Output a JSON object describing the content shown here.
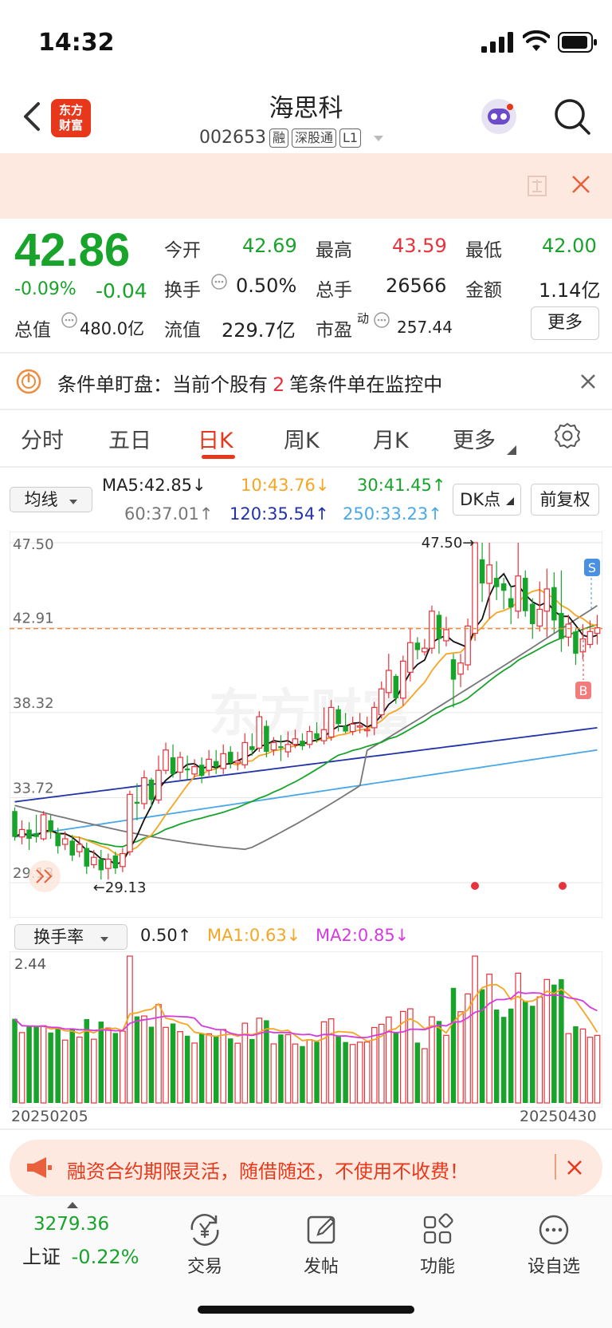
{
  "status": {
    "time": "14:32"
  },
  "header": {
    "logo_line1": "东方",
    "logo_line2": "财富",
    "stock_name": "海思科",
    "stock_code": "002653",
    "tags": [
      "融",
      "深股通",
      "L1"
    ]
  },
  "banner_top": {
    "close": "✕"
  },
  "quote": {
    "price": "42.86",
    "change_pct": "-0.09%",
    "change": "-0.04",
    "open_label": "今开",
    "open": "42.69",
    "high_label": "最高",
    "high": "43.59",
    "low_label": "最低",
    "low": "42.00",
    "turnover_label": "换手",
    "turnover": "0.50%",
    "volume_label": "总手",
    "volume": "26566",
    "amount_label": "金额",
    "amount": "1.14亿",
    "mktcap_label": "总值",
    "mktcap": "480.0亿",
    "float_label": "流值",
    "float": "229.7亿",
    "pe_label": "市盈",
    "pe_sup": "动",
    "pe": "257.44",
    "more": "更多"
  },
  "condition": {
    "prefix": "条件单盯盘：当前个股有",
    "count": "2",
    "suffix": "笔条件单在监控中",
    "close": "✕"
  },
  "tabs": [
    "分时",
    "五日",
    "日K",
    "周K",
    "月K",
    "更多"
  ],
  "ma_row": {
    "selector": "均线",
    "ma5": "MA5:42.85↓",
    "ma10": "10:43.76↓",
    "ma30": "30:41.45↑",
    "ma60": "60:37.01↑",
    "ma120": "120:35.54↑",
    "ma250": "250:33.23↑",
    "dk": "DK点",
    "fq": "前复权"
  },
  "colors": {
    "up": "#e8333c",
    "down": "#18a32a",
    "accent": "#e8381c"
  },
  "chart_data": {
    "type": "candlestick",
    "y_ticks": [
      "47.50",
      "42.91",
      "38.32",
      "33.72",
      "29.13"
    ],
    "ylim": [
      29.13,
      47.5
    ],
    "current_price_line": 42.86,
    "max_label": "47.50→",
    "min_label": "←29.13",
    "start_date": "20250205",
    "end_date": "20250430",
    "candles": [
      [
        33.0,
        31.6,
        33.2,
        31.4
      ],
      [
        31.6,
        32.0,
        32.5,
        31.2
      ],
      [
        32.0,
        31.5,
        32.4,
        30.9
      ],
      [
        31.8,
        31.6,
        32.8,
        31.3
      ],
      [
        31.5,
        32.8,
        33.0,
        31.4
      ],
      [
        32.5,
        31.9,
        32.8,
        31.5
      ],
      [
        31.8,
        31.1,
        32.1,
        30.7
      ],
      [
        31.2,
        31.5,
        31.9,
        30.9
      ],
      [
        31.4,
        30.6,
        31.7,
        30.3
      ],
      [
        30.8,
        31.2,
        31.6,
        30.5
      ],
      [
        31.0,
        30.0,
        31.3,
        29.6
      ],
      [
        30.1,
        30.5,
        30.9,
        29.9
      ],
      [
        30.4,
        29.8,
        30.9,
        29.3
      ],
      [
        29.9,
        30.4,
        30.7,
        29.3
      ],
      [
        30.6,
        29.9,
        30.8,
        29.6
      ],
      [
        30.0,
        30.7,
        31.0,
        29.7
      ],
      [
        30.8,
        33.9,
        34.1,
        30.6
      ],
      [
        33.5,
        33.4,
        34.5,
        32.5
      ],
      [
        33.4,
        34.8,
        35.2,
        33.1
      ],
      [
        34.7,
        33.6,
        34.8,
        33.2
      ],
      [
        33.6,
        35.2,
        36.0,
        33.4
      ],
      [
        35.2,
        36.3,
        36.7,
        35.0
      ],
      [
        35.9,
        35.0,
        36.6,
        34.8
      ],
      [
        35.1,
        35.9,
        36.2,
        34.7
      ],
      [
        35.3,
        35.2,
        36.0,
        34.7
      ],
      [
        35.0,
        35.4,
        35.8,
        34.8
      ],
      [
        35.5,
        34.9,
        35.9,
        34.5
      ],
      [
        35.2,
        35.8,
        36.3,
        34.9
      ],
      [
        35.7,
        35.4,
        36.3,
        35.0
      ],
      [
        35.3,
        36.1,
        36.6,
        35.0
      ],
      [
        36.2,
        35.6,
        36.5,
        35.3
      ],
      [
        35.6,
        35.7,
        36.2,
        35.2
      ],
      [
        35.5,
        36.7,
        37.2,
        35.3
      ],
      [
        36.5,
        36.3,
        37.2,
        36.0
      ],
      [
        36.4,
        38.1,
        38.4,
        36.2
      ],
      [
        37.6,
        36.2,
        37.9,
        35.9
      ],
      [
        36.3,
        36.7,
        37.0,
        36.0
      ],
      [
        36.5,
        36.4,
        37.1,
        35.7
      ],
      [
        36.2,
        36.6,
        37.3,
        35.9
      ],
      [
        36.6,
        36.9,
        37.4,
        36.4
      ],
      [
        36.8,
        36.5,
        37.2,
        36.3
      ],
      [
        36.6,
        37.3,
        37.6,
        36.4
      ],
      [
        37.2,
        36.9,
        37.8,
        36.7
      ],
      [
        36.8,
        37.4,
        38.6,
        36.6
      ],
      [
        37.0,
        38.6,
        39.0,
        36.8
      ],
      [
        38.5,
        37.7,
        38.7,
        37.3
      ],
      [
        37.6,
        37.3,
        38.3,
        37.2
      ],
      [
        37.3,
        37.7,
        38.1,
        37.1
      ],
      [
        37.6,
        37.6,
        38.3,
        37.2
      ],
      [
        37.4,
        37.4,
        38.1,
        37.0
      ],
      [
        37.5,
        38.6,
        38.9,
        37.1
      ],
      [
        38.2,
        39.6,
        40.0,
        38.0
      ],
      [
        39.4,
        40.6,
        41.5,
        39.1
      ],
      [
        40.3,
        39.1,
        40.4,
        38.8
      ],
      [
        39.1,
        41.1,
        41.4,
        38.7
      ],
      [
        40.5,
        42.1,
        42.9,
        40.0
      ],
      [
        42.1,
        41.7,
        42.4,
        41.2
      ],
      [
        41.6,
        41.8,
        42.3,
        41.4
      ],
      [
        41.8,
        43.8,
        44.1,
        41.5
      ],
      [
        43.6,
        42.3,
        43.8,
        41.5
      ],
      [
        42.2,
        42.8,
        43.5,
        41.9
      ],
      [
        41.2,
        40.1,
        41.5,
        38.6
      ],
      [
        40.4,
        41.0,
        41.5,
        39.7
      ],
      [
        40.9,
        43.0,
        43.4,
        40.6
      ],
      [
        42.6,
        47.5,
        47.5,
        42.2
      ],
      [
        46.6,
        45.3,
        47.5,
        44.3
      ],
      [
        45.3,
        46.3,
        47.5,
        43.4
      ],
      [
        45.6,
        45.1,
        46.5,
        44.4
      ],
      [
        45.3,
        44.9,
        45.6,
        43.9
      ],
      [
        44.5,
        44.0,
        45.2,
        43.1
      ],
      [
        43.8,
        45.7,
        47.5,
        43.4
      ],
      [
        45.6,
        43.8,
        46.0,
        43.5
      ],
      [
        44.2,
        43.1,
        44.5,
        42.3
      ],
      [
        43.0,
        43.9,
        45.4,
        42.7
      ],
      [
        43.8,
        45.0,
        46.1,
        42.4
      ],
      [
        45.1,
        43.3,
        45.9,
        42.6
      ],
      [
        43.7,
        42.3,
        46.0,
        41.6
      ],
      [
        42.4,
        43.1,
        43.6,
        41.9
      ],
      [
        42.7,
        41.5,
        42.9,
        40.9
      ],
      [
        41.6,
        42.3,
        43.1,
        41.2
      ],
      [
        42.0,
        42.7,
        43.3,
        41.8
      ],
      [
        42.6,
        42.9,
        43.6,
        42.0
      ]
    ]
  },
  "turnover": {
    "selector": "换手率",
    "value": "0.50↑",
    "ma1": "MA1:0.63↓",
    "ma2": "MA2:0.85↓",
    "max": "2.44"
  },
  "bottom_banner": {
    "text": "融资合约期限灵活，随借随还，不使用不收费！",
    "close": "✕"
  },
  "tabbar": {
    "index_value": "3279.36",
    "index_name": "上证",
    "index_change": "-0.22%",
    "items": [
      "交易",
      "发帖",
      "功能",
      "设自选"
    ]
  }
}
